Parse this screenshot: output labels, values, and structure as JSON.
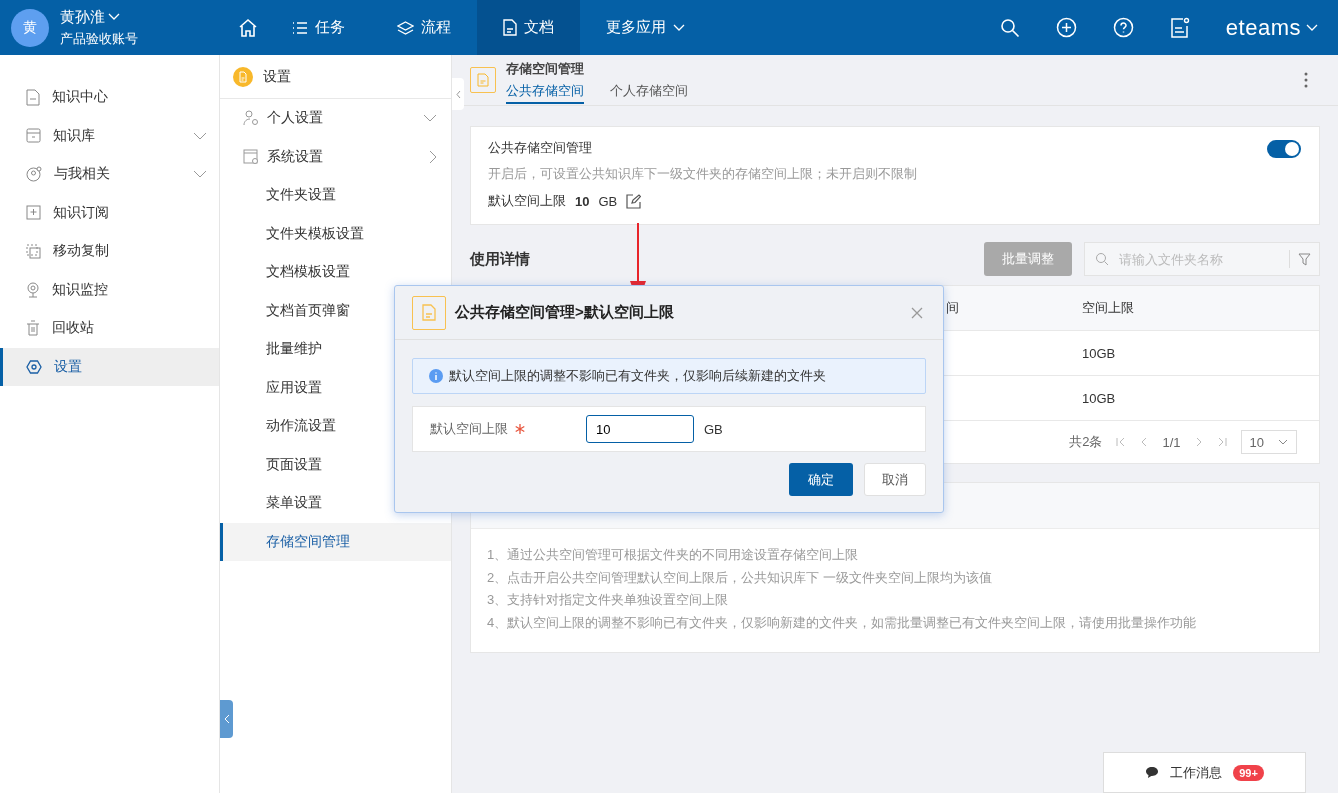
{
  "user": {
    "avatar": "黄",
    "name": "黄孙淮",
    "account": "产品验收账号"
  },
  "nav": [
    {
      "kind": "home",
      "selected": false
    },
    {
      "kind": "list",
      "label": "任务",
      "selected": false
    },
    {
      "kind": "layers",
      "label": "流程",
      "selected": false
    },
    {
      "kind": "doc",
      "label": "文档",
      "selected": true
    },
    {
      "kind": "more",
      "label": "更多应用",
      "selected": false
    }
  ],
  "brand": "eteams",
  "sidebar": {
    "items": [
      {
        "kind": "doc",
        "label": "知识中心",
        "has_menu": false,
        "selected": false
      },
      {
        "kind": "box",
        "label": "知识库",
        "has_menu": true,
        "selected": false
      },
      {
        "kind": "person",
        "label": "与我相关",
        "has_menu": true,
        "selected": false
      },
      {
        "kind": "sub",
        "label": "知识订阅",
        "has_menu": false,
        "selected": false
      },
      {
        "kind": "move",
        "label": "移动复制",
        "has_menu": false,
        "selected": false
      },
      {
        "kind": "cam",
        "label": "知识监控",
        "has_menu": false,
        "selected": false
      },
      {
        "kind": "bin",
        "label": "回收站",
        "has_menu": false,
        "selected": false
      },
      {
        "kind": "gear",
        "label": "设置",
        "has_menu": false,
        "selected": true
      }
    ]
  },
  "settings_menu": {
    "title": "设置",
    "items": [
      {
        "kind": "group",
        "label": "个人设置",
        "expanded": false,
        "selected": false
      },
      {
        "kind": "group",
        "label": "系统设置",
        "expanded": true,
        "selected": false
      },
      {
        "kind": "item",
        "label": "文件夹设置",
        "selected": false
      },
      {
        "kind": "item",
        "label": "文件夹模板设置",
        "selected": false
      },
      {
        "kind": "item",
        "label": "文档模板设置",
        "selected": false
      },
      {
        "kind": "item",
        "label": "文档首页弹窗",
        "selected": false
      },
      {
        "kind": "item",
        "label": "批量维护",
        "selected": false
      },
      {
        "kind": "item",
        "label": "应用设置",
        "selected": false
      },
      {
        "kind": "item",
        "label": "动作流设置",
        "selected": false
      },
      {
        "kind": "item",
        "label": "页面设置",
        "selected": false
      },
      {
        "kind": "item",
        "label": "菜单设置",
        "selected": false
      },
      {
        "kind": "item",
        "label": "存储空间管理",
        "selected": true
      }
    ]
  },
  "page": {
    "title": "存储空间管理",
    "tabs": [
      {
        "label": "公共存储空间",
        "selected": true
      },
      {
        "label": "个人存储空间",
        "selected": false
      }
    ]
  },
  "setting_card": {
    "title": "公共存储空间管理",
    "description": "开启后，可设置公共知识库下一级文件夹的存储空间上限；未开启则不限制",
    "limit_label": "默认空间上限",
    "limit_value": "10",
    "limit_unit": "GB",
    "on": true
  },
  "usage": {
    "title": "使用详情",
    "batch_button": "批量调整",
    "batch_disabled": true,
    "search_placeholder": "请输入文件夹名称",
    "columns": [
      "间",
      "空间上限"
    ],
    "rows": [
      {
        "limit": "10GB"
      },
      {
        "limit": "10GB"
      }
    ],
    "total": "共2条",
    "page": "1/1",
    "page_size": "10"
  },
  "tips": [
    "1、通过公共空间管理可根据文件夹的不同用途设置存储空间上限",
    "2、点击开启公共空间管理默认空间上限后，公共知识库下 一级文件夹空间上限均为该值",
    "3、支持针对指定文件夹单独设置空间上限",
    "4、默认空间上限的调整不影响已有文件夹，仅影响新建的文件夹，如需批量调整已有文件夹空间上限，请使用批量操作功能"
  ],
  "dialog": {
    "title": "公共存储空间管理>默认空间上限",
    "notice": "默认空间上限的调整不影响已有文件夹，仅影响后续新建的文件夹",
    "field_label": "默认空间上限",
    "required": true,
    "value": "10",
    "unit": "GB",
    "ok": "确定",
    "cancel": "取消"
  },
  "chat": {
    "label": "工作消息",
    "badge": "99+"
  }
}
